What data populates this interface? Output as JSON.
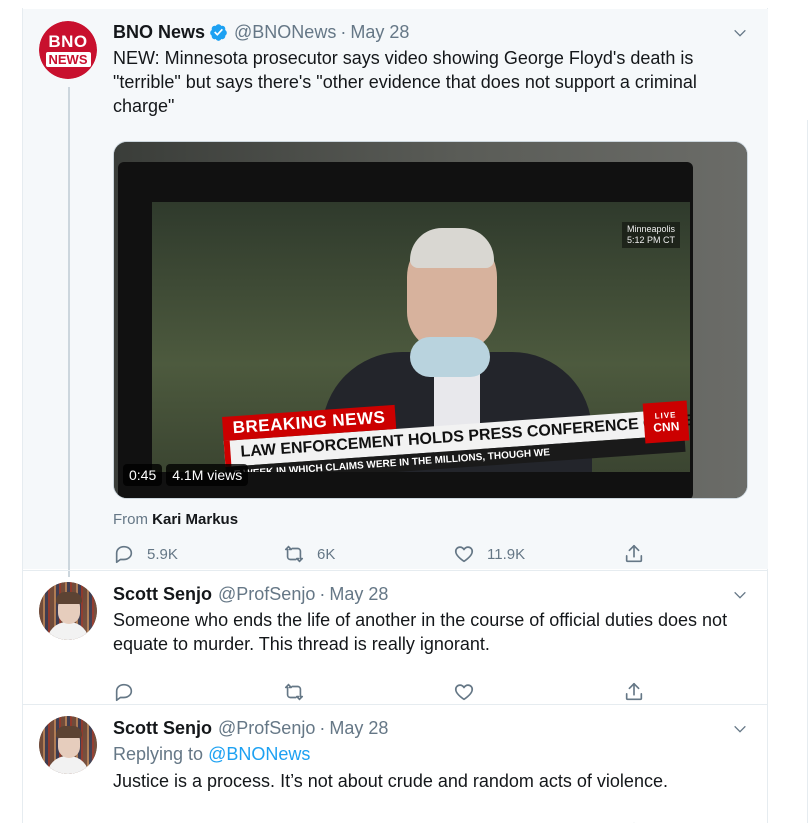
{
  "tweets": [
    {
      "name": "BNO News",
      "handle": "@BNONews",
      "sep": "·",
      "date": "May 28",
      "avatar_text_top": "BNO",
      "avatar_text_bottom": "NEWS",
      "text": "NEW: Minnesota prosecutor says video showing George Floyd's death is \"terrible\" but says there's \"other evidence that does not support a criminal charge\"",
      "video": {
        "duration": "0:45",
        "views": "4.1M views",
        "location": "Minneapolis",
        "time": "5:12 PM CT",
        "breaking": "BREAKING NEWS",
        "headline": "LAW ENFORCEMENT HOLDS PRESS CONFERENCE ON GEORGE FLOYD'S DEATH",
        "ticker": "E WEEK IN WHICH CLAIMS WERE IN THE MILLIONS, THOUGH WE",
        "network": "CNN",
        "live": "LIVE"
      },
      "from_label": "From",
      "from_name": "Kari Markus",
      "replies": "5.9K",
      "retweets": "6K",
      "likes": "11.9K"
    },
    {
      "name": "Scott Senjo",
      "handle": "@ProfSenjo",
      "sep": "·",
      "date": "May 28",
      "text": "Someone who ends the life of another in the course of official duties does not equate to murder.  This thread is really ignorant."
    },
    {
      "name": "Scott Senjo",
      "handle": "@ProfSenjo",
      "sep": "·",
      "date": "May 28",
      "replying_label": "Replying to",
      "replying_to": "@BNONews",
      "text": "Justice is a process.  It’s not about crude and random acts of violence."
    }
  ],
  "icons": {
    "verified": "verified-badge-icon",
    "chevron": "chevron-down-icon",
    "reply": "reply-icon",
    "retweet": "retweet-icon",
    "like": "heart-icon",
    "share": "share-icon"
  },
  "colors": {
    "brand_blue": "#1da1f2",
    "bno_red": "#c8102e",
    "muted": "#657786",
    "highlight_bg": "#f5f8fa"
  }
}
